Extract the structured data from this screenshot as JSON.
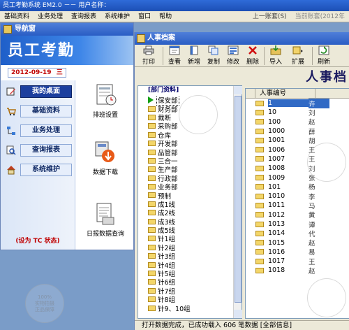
{
  "window": {
    "title": "员工考勤系统 EM2.0  －－ 用户名称：",
    "menu": [
      "基础资料",
      "业务处理",
      "查询报表",
      "系统维护",
      "窗口",
      "帮助"
    ],
    "right_menu": [
      "上一账套(S)",
      "当前账套(2012年"
    ]
  },
  "nav_window": {
    "title": "导航窗",
    "brand": "员工考勤",
    "date": "2012-09-19",
    "date_weekday": "三",
    "buttons": [
      "我的桌面",
      "基础资料",
      "业务处理",
      "查询报表",
      "系统维护"
    ],
    "active": "我的桌面",
    "status": "(设为 TC 状态)",
    "functions": [
      "排班设置",
      "数据下载",
      "日报数据查询"
    ]
  },
  "hr_window": {
    "title": "人事档案",
    "big_title": "人事档",
    "toolbar": [
      "打印",
      "查看",
      "新增",
      "复制",
      "修改",
      "删除",
      "导入",
      "扩展",
      "刷新"
    ],
    "dept_header": "[部门资料]",
    "departments": [
      "保安部",
      "财务部",
      "裁断",
      "采购部",
      "仓库",
      "开发部",
      "品管部",
      "三合一",
      "生产部",
      "行政部",
      "业务部",
      "预制",
      "成1线",
      "成2线",
      "成3线",
      "成5线",
      "针1组",
      "针2组",
      "针3组",
      "针4组",
      "针5组",
      "针6组",
      "针7组",
      "针8组",
      "针9、10组"
    ],
    "selected_department": "保安部",
    "employee_header": "人事编号",
    "employees": [
      {
        "code": "1",
        "name": "许"
      },
      {
        "code": "10",
        "name": "刘"
      },
      {
        "code": "100",
        "name": "赵"
      },
      {
        "code": "1000",
        "name": "薛"
      },
      {
        "code": "1001",
        "name": "胡"
      },
      {
        "code": "1006",
        "name": "王"
      },
      {
        "code": "1007",
        "name": "王"
      },
      {
        "code": "1008",
        "name": "刘"
      },
      {
        "code": "1009",
        "name": "张"
      },
      {
        "code": "101",
        "name": "杨"
      },
      {
        "code": "1010",
        "name": "李"
      },
      {
        "code": "1011",
        "name": "马"
      },
      {
        "code": "1012",
        "name": "黄"
      },
      {
        "code": "1013",
        "name": "谭"
      },
      {
        "code": "1014",
        "name": "代"
      },
      {
        "code": "1015",
        "name": "赵"
      },
      {
        "code": "1016",
        "name": "易"
      },
      {
        "code": "1017",
        "name": "王"
      },
      {
        "code": "1018",
        "name": "赵"
      }
    ],
    "status": "打开数据完成，已成功载入 606 笔数据 [全部信息]"
  },
  "watermark_text": "100%\n实物拍摄\n正品保障"
}
